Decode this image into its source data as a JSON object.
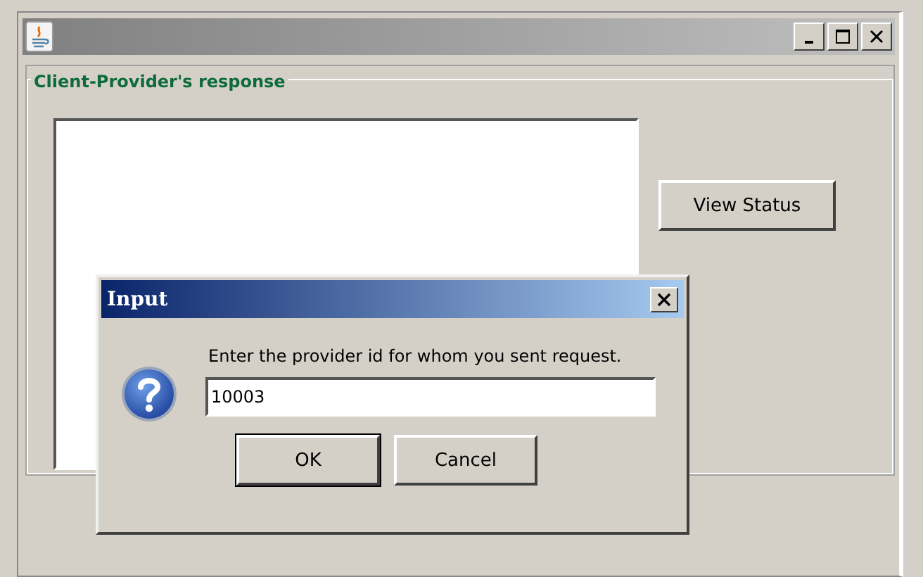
{
  "window": {
    "group_title": "Client-Provider's response",
    "buttons": [
      "View Status"
    ]
  },
  "dialog": {
    "title": "Input",
    "message": "Enter the provider id for whom you sent request.",
    "field": {
      "value": "10003"
    },
    "buttons": [
      "OK",
      "Cancel"
    ]
  }
}
